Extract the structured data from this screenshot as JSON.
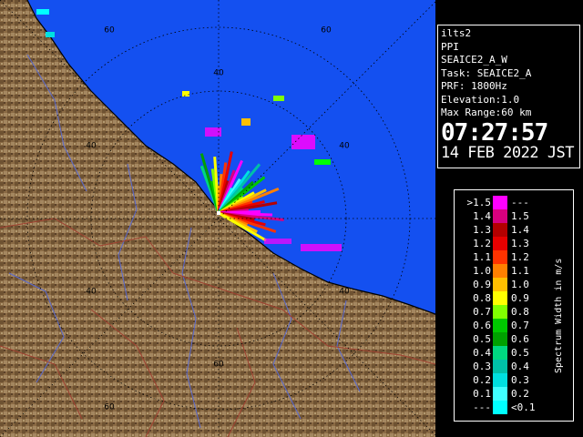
{
  "info": {
    "radar": "ilts2",
    "scan_type": "PPI",
    "product": "SEAICE2_A_W",
    "task": "Task: SEAICE2_A",
    "prf": "PRF: 1800Hz",
    "elevation": "Elevation:1.0",
    "max_range": "Max Range:60 km",
    "time": "07:27:57",
    "date": "14 FEB 2022 JST"
  },
  "range_rings": [
    {
      "text": "60"
    },
    {
      "text": "60"
    },
    {
      "text": "40"
    },
    {
      "text": "40"
    },
    {
      "text": "40"
    },
    {
      "text": "40"
    },
    {
      "text": "40"
    },
    {
      "text": "60"
    },
    {
      "text": "60"
    }
  ],
  "legend": {
    "unit": "Spectrum Width in m/s",
    "rows": [
      {
        "lo": ">1.5",
        "hi": "---",
        "color": "#ff00ff"
      },
      {
        "lo": "1.4",
        "hi": "1.5",
        "color": "#d8007f"
      },
      {
        "lo": "1.3",
        "hi": "1.4",
        "color": "#b40000"
      },
      {
        "lo": "1.2",
        "hi": "1.3",
        "color": "#e60000"
      },
      {
        "lo": "1.1",
        "hi": "1.2",
        "color": "#ff3300"
      },
      {
        "lo": "1.0",
        "hi": "1.1",
        "color": "#ff8000"
      },
      {
        "lo": "0.9",
        "hi": "1.0",
        "color": "#ffbf00"
      },
      {
        "lo": "0.8",
        "hi": "0.9",
        "color": "#ffff00"
      },
      {
        "lo": "0.7",
        "hi": "0.8",
        "color": "#80ff00"
      },
      {
        "lo": "0.6",
        "hi": "0.7",
        "color": "#00c800"
      },
      {
        "lo": "0.5",
        "hi": "0.6",
        "color": "#00a000"
      },
      {
        "lo": "0.4",
        "hi": "0.5",
        "color": "#00d880"
      },
      {
        "lo": "0.3",
        "hi": "0.4",
        "color": "#00c0a8"
      },
      {
        "lo": "0.2",
        "hi": "0.3",
        "color": "#00e0e0"
      },
      {
        "lo": "0.1",
        "hi": "0.2",
        "color": "#40ffff"
      },
      {
        "lo": "---",
        "hi": "<0.1",
        "color": "#00ffff"
      }
    ]
  },
  "colors": {
    "sea": "#1450f0",
    "land": "#8a6a44",
    "river": "#5a6ad0",
    "border": "#a04030",
    "grid": "#000000",
    "background": "#000000"
  }
}
